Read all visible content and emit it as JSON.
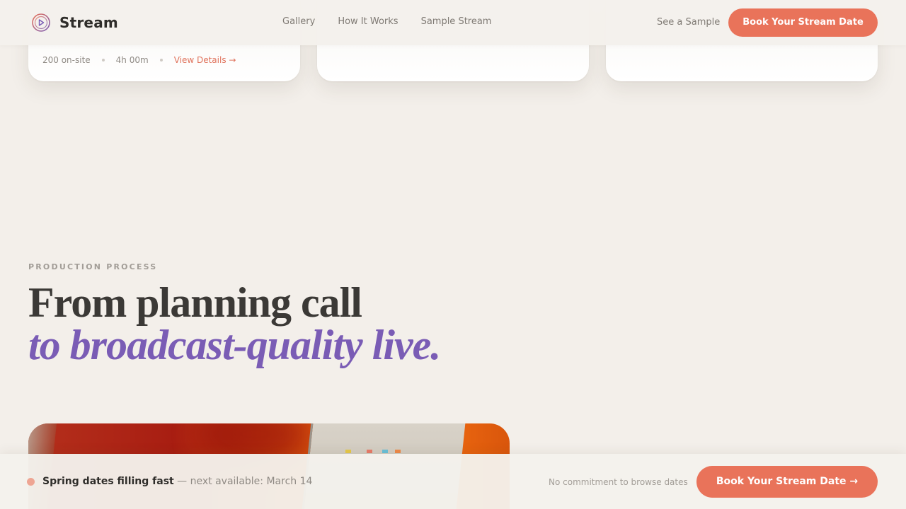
{
  "brand": {
    "name": "Stream",
    "accent": "#e9735a",
    "logo_colors": [
      "#e9735a",
      "#7a5cb5"
    ]
  },
  "header": {
    "nav": [
      "Gallery",
      "How It Works",
      "Sample Stream"
    ],
    "see_sample": "See a Sample",
    "cta": "Book Your Stream Date"
  },
  "cards": [
    {
      "attendees": "200 on-site",
      "duration": "4h 00m",
      "link": "View Details →"
    },
    {},
    {}
  ],
  "section": {
    "eyebrow": "PRODUCTION PROCESS",
    "headline_line1": "From planning call",
    "headline_line2": "to broadcast-quality live.",
    "accent_purple": "#7a5cb5"
  },
  "bottom_bar": {
    "status_strong": "Spring dates filling fast",
    "status_rest": " — next available: March 14",
    "note": "No commitment to browse dates",
    "cta": "Book Your Stream Date →"
  }
}
